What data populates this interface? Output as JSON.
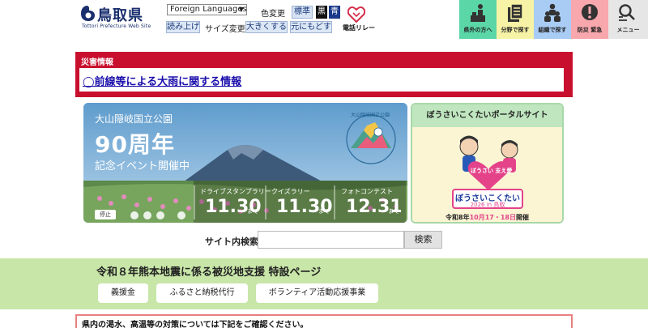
{
  "header": {
    "logo_name": "鳥取県",
    "logo_sub": "Tottori Prefecture Web Site",
    "language_select": "Foreign Languages",
    "color_label": "色変更",
    "color_standard": "標準",
    "color_black": "黒",
    "color_blue": "青",
    "read_aloud": "読み上げ",
    "size_label": "サイズ変更",
    "size_bigger": "大きくする",
    "size_reset": "元にもどす",
    "tel_relay": "電話リレー"
  },
  "nav": [
    {
      "label": "県外の方へ",
      "color": "#5bd6a7"
    },
    {
      "label": "分野で探す",
      "color": "#f7f3a6"
    },
    {
      "label": "組織で探す",
      "color": "#a9ccf5"
    },
    {
      "label": "防災 緊急",
      "color": "#f8a7ad"
    },
    {
      "label": "メニュー",
      "color": "#e6e6e6"
    }
  ],
  "disaster": {
    "title": "災害情報",
    "link": "◯前線等による大雨に関する情報"
  },
  "slide": {
    "sub_title": "大山隠岐国立公園",
    "big_title": "90周年",
    "event_title": "記念イベント開催中",
    "emblem": "大山隠岐国立公園",
    "events": [
      {
        "name": "ドライブスタンプラリー",
        "date": "11.30",
        "until": "まで"
      },
      {
        "name": "クイズラリー",
        "date": "11.30",
        "until": "まで"
      },
      {
        "name": "フォトコンテスト",
        "date": "12.31",
        "until": "まで"
      }
    ],
    "pause": "停止"
  },
  "portal": {
    "title": "ぼうさいこくたいポータルサイト",
    "heart": "ぼうさい 支え愛",
    "badge_title": "ぼうさいこくたい",
    "badge_sub": "2026 in 鳥取",
    "date_prefix": "令和8年",
    "date_highlight": "10月17・18日",
    "date_suffix": "開催"
  },
  "search": {
    "label": "サイト内検索",
    "placeholder": "",
    "button": "検索"
  },
  "quake": {
    "title": "令和８年熊本地震に係る被災地支援 特設ページ",
    "buttons": [
      "義援金",
      "ふるさと納税代行",
      "ボランティア活動応援事業"
    ]
  },
  "water": {
    "text": "県内の渇水、高温等の対策については下記をご確認ください。"
  },
  "colors": {
    "disaster_red": "#c8102e",
    "brand_navy": "#1a2f6e",
    "quake_green": "#c8e6a8"
  }
}
